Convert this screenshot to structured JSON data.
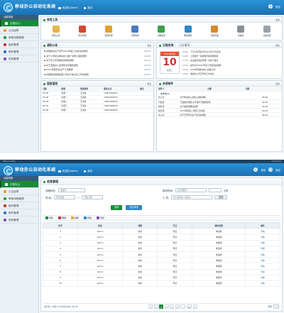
{
  "app": {
    "title": "移动办公自动化系统",
    "welcome": "欢迎您,Admin",
    "logout": "退出",
    "home": "首页",
    "exit": "退出"
  },
  "topbar": {
    "left": "Office System",
    "right": "V2.0.2014"
  },
  "sidebar": {
    "title": "功能导航",
    "items": [
      {
        "label": "日常办公",
        "color": "#1a8a3a",
        "active": true
      },
      {
        "label": "公文起草",
        "color": "#e2a72b",
        "active": false
      },
      {
        "label": "审核流程管理",
        "color": "#2f9f4a",
        "active": false
      },
      {
        "label": "组织管理",
        "color": "#c23b3b",
        "active": false
      },
      {
        "label": "邮件管理",
        "color": "#2f78c4",
        "active": false
      },
      {
        "label": "系统管理",
        "color": "#7b57b8",
        "active": false
      }
    ]
  },
  "tools": {
    "title": "常用工具",
    "more": "更多",
    "items": [
      {
        "label": "通知公告",
        "color": "#e2b84a"
      },
      {
        "label": "知识管理",
        "color": "#d4472f"
      },
      {
        "label": "权限管理",
        "color": "#e0a030"
      },
      {
        "label": "日程安排",
        "color": "#4a7bbf"
      },
      {
        "label": "流程设置",
        "color": "#3aa04a"
      },
      {
        "label": "网络硬盘",
        "color": "#2f86c8"
      },
      {
        "label": "考勤管理",
        "color": "#d68a2a"
      },
      {
        "label": "回收站",
        "color": "#8a8f96"
      },
      {
        "label": "系统配置",
        "color": "#9aa3ab"
      }
    ]
  },
  "notices": {
    "title": "通知公告",
    "more": "更多",
    "items": [
      {
        "text": "中国移动关于召开2014年度工作会议的通知",
        "date": "06-06"
      },
      {
        "text": "关于公司成立移动办公推广领导小组的通知",
        "date": "06-05"
      },
      {
        "text": "关于员工年度体检安排的通知",
        "date": "06-05"
      },
      {
        "text": "关于加强办公区域安全管理的通知",
        "date": "06-04"
      },
      {
        "text": "2014年度安全生产工作要求",
        "date": "06-03"
      },
      {
        "text": "中国移动通信集团公司关于信息化工作的通知",
        "date": "06-03"
      }
    ]
  },
  "calendar": {
    "tab_active": "日程安排",
    "tab_other": "已办事项",
    "more": "更多",
    "month": "2014年6月",
    "day": "10",
    "weekday": "星期二",
    "items": [
      {
        "time": "09:00",
        "text": "下午3点开会讨论2014年工作总结"
      },
      {
        "time": "10:00",
        "text": "上周末有一些遗留问题需要处理"
      },
      {
        "time": "11:00",
        "text": "在出差回来后安排一次部门会议"
      },
      {
        "time": "14:00",
        "text": "起草关于2014年度工作目标的通知"
      },
      {
        "time": "15:00",
        "text": "2014年度移动办公系统上线"
      },
      {
        "time": "16:00",
        "text": "参加市公司召开的工作会议"
      }
    ]
  },
  "duty": {
    "title": "值班值班",
    "more": "更多",
    "headers": [
      "日期",
      "星期",
      "值班领导",
      "联系方式",
      "备注"
    ],
    "rows": [
      [
        "05-08",
        "星期一",
        "王海龙",
        "13903949876",
        ""
      ],
      [
        "05-08",
        "星期一",
        "王海龙",
        "13903949876",
        ""
      ],
      [
        "05-09",
        "星期二",
        "王海龙",
        "13903949876",
        ""
      ],
      [
        "05-10",
        "星期三",
        "王海龙",
        "13903949876",
        ""
      ],
      [
        "05-08",
        "星期一",
        "王海龙",
        "13903949876",
        ""
      ]
    ]
  },
  "mail": {
    "title": "未读邮件",
    "more": "更多",
    "headers": [
      "发件人",
      "主题",
      "日期"
    ],
    "category": "收件箱(5)",
    "rows": [
      [
        "办公室",
        "关于移动办公系统上线的通知",
        "06-06"
      ],
      [
        "行政部",
        "行政事务通知:关于端午节放假安排",
        "06-05"
      ],
      [
        "财务部",
        "关于报销流程的说明",
        "06-05"
      ],
      [
        "综合部",
        "2014年度第二季度工作总结",
        "06-04"
      ],
      [
        "办公室",
        "关于召开安全生产会议的通知",
        "06-04"
      ]
    ]
  },
  "form_page": {
    "title": "信息管理",
    "status_label": "流程状态:",
    "status_value": "请选择",
    "type_label": "操作时间:",
    "type_value": "文字或整手",
    "time_label": "时    间:",
    "time_from": "开始日期",
    "time_to": "开始日期",
    "person_label": "人    员:",
    "person_placeholder": "可以选择多个发起人",
    "select_button": "选择",
    "query_button": "查询",
    "clear_button": "清空条件",
    "hour_suffix": "小时",
    "actions": [
      "添加",
      "删除",
      "编辑",
      "修改",
      "导出"
    ],
    "table_headers": [
      "序号",
      "姓名",
      "流程",
      "节点",
      "操作说明",
      "操作"
    ],
    "rows": [
      [
        "1",
        "admin",
        "收文",
        "登记",
        "未完成",
        "查看"
      ],
      [
        "2",
        "admin",
        "收文",
        "登记",
        "未完成",
        "查看"
      ],
      [
        "3",
        "admin",
        "收文",
        "登记",
        "未完成",
        "查看"
      ],
      [
        "4",
        "admin",
        "收文",
        "登记",
        "未完成",
        "查看"
      ],
      [
        "5",
        "admin",
        "收文",
        "登记",
        "未完成",
        "查看"
      ],
      [
        "6",
        "admin",
        "收文",
        "登记",
        "未完成",
        "查看"
      ],
      [
        "7",
        "admin",
        "收文",
        "登记",
        "未完成",
        "查看"
      ],
      [
        "8",
        "admin",
        "收文",
        "登记",
        "未完成",
        "查看"
      ],
      [
        "9",
        "admin",
        "收文",
        "登记",
        "未完成",
        "查看"
      ],
      [
        "10",
        "admin",
        "收文",
        "登记",
        "未完成",
        "查看"
      ]
    ],
    "pager_info": "显示第 1 到第 10 条记录,总共 100 条",
    "pages": [
      "<",
      "1",
      "2",
      "3",
      "4",
      "5",
      "...",
      "10",
      ">"
    ],
    "current_page": "2",
    "jump_label": "转到",
    "page_size": "10"
  }
}
